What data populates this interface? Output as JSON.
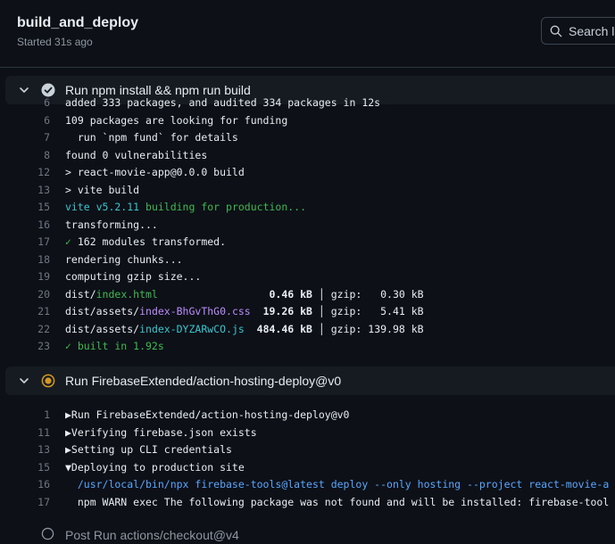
{
  "job": {
    "title": "build_and_deploy",
    "subtitle": "Started 31s ago"
  },
  "search": {
    "placeholder": "Search l"
  },
  "steps": [
    {
      "title": "Run npm install && npm run build",
      "status": "success",
      "expanded": true,
      "lines": [
        {
          "n": "6",
          "parts": [
            {
              "t": "added 333 packages, and audited 334 packages in 12s",
              "c": ""
            }
          ]
        },
        {
          "n": "6",
          "parts": [
            {
              "t": "109 packages are looking for funding",
              "c": ""
            }
          ]
        },
        {
          "n": "7",
          "parts": [
            {
              "t": "  run `npm fund` for details",
              "c": ""
            }
          ]
        },
        {
          "n": "8",
          "parts": [
            {
              "t": "found 0 vulnerabilities",
              "c": ""
            }
          ]
        },
        {
          "n": "12",
          "parts": [
            {
              "t": "> react-movie-app@0.0.0 build",
              "c": ""
            }
          ]
        },
        {
          "n": "13",
          "parts": [
            {
              "t": "> vite build",
              "c": ""
            }
          ]
        },
        {
          "n": "15",
          "parts": [
            {
              "t": "vite v5.2.11",
              "c": "cyan"
            },
            {
              "t": " building for production...",
              "c": "green"
            }
          ]
        },
        {
          "n": "16",
          "parts": [
            {
              "t": "transforming...",
              "c": ""
            }
          ]
        },
        {
          "n": "17",
          "parts": [
            {
              "t": "✓",
              "c": "green"
            },
            {
              "t": " 162 modules transformed.",
              "c": ""
            }
          ]
        },
        {
          "n": "18",
          "parts": [
            {
              "t": "rendering chunks...",
              "c": ""
            }
          ]
        },
        {
          "n": "19",
          "parts": [
            {
              "t": "computing gzip size...",
              "c": ""
            }
          ]
        },
        {
          "n": "20",
          "parts": [
            {
              "t": "dist/",
              "c": ""
            },
            {
              "t": "index.html",
              "c": "green"
            },
            {
              "t": "                  ",
              "c": ""
            },
            {
              "t": "0.46 kB",
              "c": "bold"
            },
            {
              "t": " │ gzip:   0.30 kB",
              "c": ""
            }
          ]
        },
        {
          "n": "21",
          "parts": [
            {
              "t": "dist/assets/",
              "c": ""
            },
            {
              "t": "index-BhGvThG0.css",
              "c": "magenta"
            },
            {
              "t": "  ",
              "c": ""
            },
            {
              "t": "19.26 kB",
              "c": "bold"
            },
            {
              "t": " │ gzip:   5.41 kB",
              "c": ""
            }
          ]
        },
        {
          "n": "22",
          "parts": [
            {
              "t": "dist/assets/",
              "c": ""
            },
            {
              "t": "index-DYZARwCO.js",
              "c": "cyan"
            },
            {
              "t": "  ",
              "c": ""
            },
            {
              "t": "484.46 kB",
              "c": "bold"
            },
            {
              "t": " │ gzip: 139.98 kB",
              "c": ""
            }
          ]
        },
        {
          "n": "23",
          "parts": [
            {
              "t": "✓ built in 1.92s",
              "c": "green"
            }
          ]
        }
      ]
    },
    {
      "title": "Run FirebaseExtended/action-hosting-deploy@v0",
      "status": "in_progress",
      "expanded": true,
      "lines": [
        {
          "n": "1",
          "parts": [
            {
              "t": "▶Run FirebaseExtended/action-hosting-deploy@v0",
              "c": ""
            }
          ]
        },
        {
          "n": "11",
          "parts": [
            {
              "t": "▶Verifying firebase.json exists",
              "c": ""
            }
          ]
        },
        {
          "n": "13",
          "parts": [
            {
              "t": "▶Setting up CLI credentials",
              "c": ""
            }
          ]
        },
        {
          "n": "15",
          "parts": [
            {
              "t": "▼Deploying to production site",
              "c": ""
            }
          ]
        },
        {
          "n": "16",
          "parts": [
            {
              "t": "  /usr/local/bin/npx firebase-tools@latest deploy --only hosting --project react-movie-a",
              "c": "blue"
            }
          ]
        },
        {
          "n": "17",
          "parts": [
            {
              "t": "  npm WARN exec The following package was not found and will be installed: firebase-tool",
              "c": ""
            }
          ]
        }
      ]
    },
    {
      "title": "Post Run actions/checkout@v4",
      "status": "pending",
      "expanded": false
    }
  ],
  "colors": {
    "success": "#8d96a0",
    "in_progress": "#d29922",
    "pending": "#8d96a0"
  }
}
